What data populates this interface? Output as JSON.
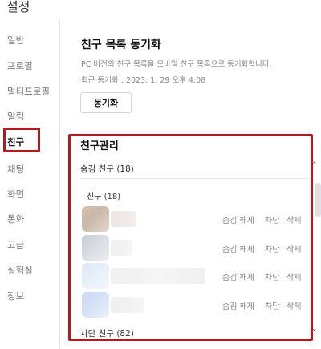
{
  "window": {
    "title": "설정"
  },
  "sidebar": {
    "items": [
      {
        "label": "일반"
      },
      {
        "label": "프로필"
      },
      {
        "label": "멀티프로필"
      },
      {
        "label": "알림"
      },
      {
        "label": "친구"
      },
      {
        "label": "채팅"
      },
      {
        "label": "화면"
      },
      {
        "label": "통화"
      },
      {
        "label": "고급"
      },
      {
        "label": "실험실"
      },
      {
        "label": "정보"
      }
    ],
    "active": "친구"
  },
  "sync": {
    "title": "친구 목록 동기화",
    "description": "PC 버전의 친구 목록을 모바일 친구 목록으로 동기화합니다.",
    "last_sync": "최근 동기화 : 2023. 1. 29 오후 4:08",
    "button_label": "동기화"
  },
  "friend_management": {
    "title": "친구관리",
    "hidden_section_label": "숨김 친구 (18)",
    "friends_sub_label": "친구 (18)",
    "rows": [
      {
        "unhide": "숨김 해제",
        "block": "차단",
        "delete": "삭제"
      },
      {
        "unhide": "숨김 해제",
        "block": "차단",
        "delete": "삭제"
      },
      {
        "unhide": "숨김 해제",
        "block": "차단",
        "delete": "삭제"
      },
      {
        "unhide": "숨김 해제",
        "block": "차단",
        "delete": "삭제"
      }
    ],
    "blocked_section_label": "차단 친구 (82)"
  },
  "icons": {
    "collapse": "chevron-up-icon",
    "expand": "chevron-down-icon"
  },
  "colors": {
    "highlight": "#b01a23"
  }
}
